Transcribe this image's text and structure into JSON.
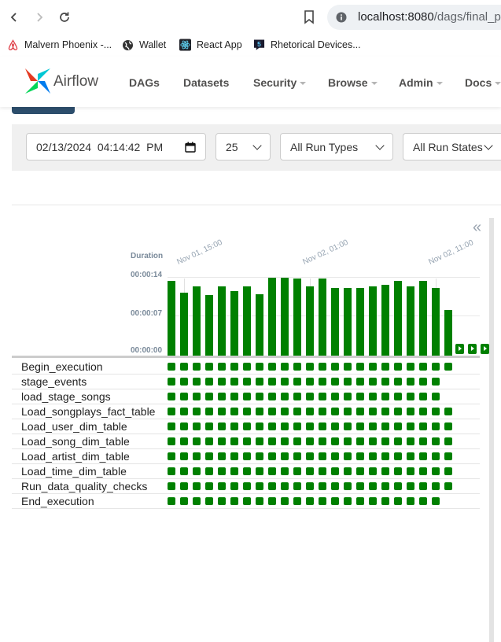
{
  "browser": {
    "url_host": "localhost:8080",
    "url_path": "/dags/final_proj",
    "bookmarks": [
      {
        "label": "Malvern Phoenix -...",
        "icon": "airbnb-icon"
      },
      {
        "label": "Wallet",
        "icon": "globe-icon"
      },
      {
        "label": "React App",
        "icon": "react-icon"
      },
      {
        "label": "Rhetorical Devices...",
        "icon": "bookmark-5-icon"
      }
    ]
  },
  "navbar": {
    "brand": "Airflow",
    "items": [
      {
        "label": "DAGs",
        "dropdown": false
      },
      {
        "label": "Datasets",
        "dropdown": false
      },
      {
        "label": "Security",
        "dropdown": true
      },
      {
        "label": "Browse",
        "dropdown": true
      },
      {
        "label": "Admin",
        "dropdown": true
      },
      {
        "label": "Docs",
        "dropdown": true
      }
    ]
  },
  "filters": {
    "base_date": "02/13/2024  04:14:42  PM",
    "num_runs": "25",
    "run_type": "All Run Types",
    "run_state": "All Run States"
  },
  "chart_data": {
    "type": "bar",
    "title": "",
    "ylabel": "Duration",
    "y_ticks": [
      "00:00:00",
      "00:00:07",
      "00:00:14"
    ],
    "ylim_seconds": [
      0,
      14
    ],
    "x_labels": [
      "Nov 01, 15:00",
      "Nov 02, 01:00",
      "Nov 02, 11:00"
    ],
    "values_seconds": [
      13.8,
      11.6,
      12.8,
      11.2,
      12.8,
      11.9,
      12.8,
      11.4,
      14.5,
      14.5,
      14.3,
      12.8,
      14.3,
      12.6,
      12.6,
      12.6,
      12.8,
      13.1,
      13.8,
      12.8,
      13.8,
      12.6,
      8.4
    ],
    "queued_runs": 3,
    "bar_color": "#008000"
  },
  "grid": {
    "tasks": [
      {
        "name": "Begin_execution",
        "cells": 23
      },
      {
        "name": "stage_events",
        "cells": 22
      },
      {
        "name": "load_stage_songs",
        "cells": 22
      },
      {
        "name": "Load_songplays_fact_table",
        "cells": 23
      },
      {
        "name": "Load_user_dim_table",
        "cells": 23
      },
      {
        "name": "Load_song_dim_table",
        "cells": 23
      },
      {
        "name": "Load_artist_dim_table",
        "cells": 23
      },
      {
        "name": "Load_time_dim_table",
        "cells": 23
      },
      {
        "name": "Run_data_quality_checks",
        "cells": 23
      },
      {
        "name": "End_execution",
        "cells": 22
      }
    ],
    "state_color": "#008000"
  }
}
